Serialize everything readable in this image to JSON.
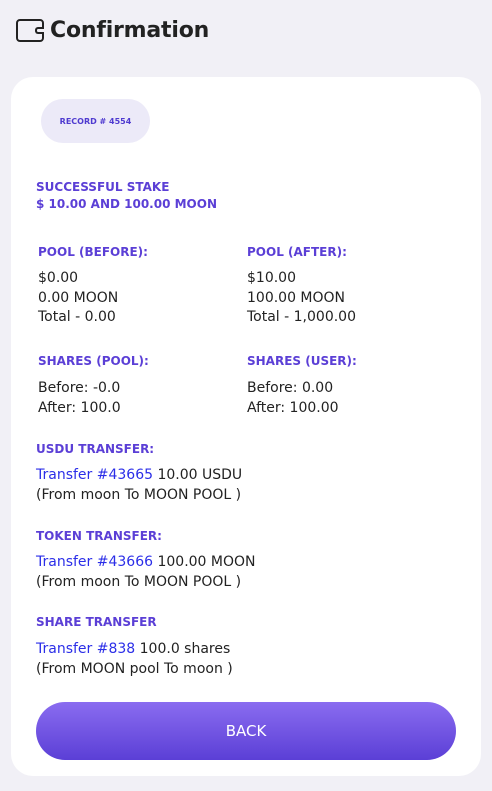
{
  "header": {
    "title": "Confirmation",
    "icon": "wallet-icon"
  },
  "record": {
    "label": "RECORD # 4554"
  },
  "summary": {
    "line1": "SUCCESSFUL STAKE",
    "line2": "$ 10.00 AND 100.00 MOON"
  },
  "pool_before": {
    "heading": "POOL (BEFORE):",
    "usd": "$0.00",
    "moon": "0.00 MOON",
    "total": "Total - 0.00"
  },
  "pool_after": {
    "heading": "POOL (AFTER):",
    "usd": "$10.00",
    "moon": "100.00 MOON",
    "total": "Total - 1,000.00"
  },
  "shares_pool": {
    "heading": "SHARES (POOL):",
    "before": "Before: -0.0",
    "after": "After: 100.0"
  },
  "shares_user": {
    "heading": "SHARES (USER):",
    "before": "Before: 0.00",
    "after": "After: 100.00"
  },
  "usdu_transfer": {
    "heading": "USDU TRANSFER:",
    "link": "Transfer #43665",
    "amount": " 10.00 USDU",
    "route": "(From moon To MOON POOL )"
  },
  "token_transfer": {
    "heading": "TOKEN TRANSFER:",
    "link": "Transfer #43666",
    "amount": " 100.00 MOON",
    "route": "(From moon To MOON POOL )"
  },
  "share_transfer": {
    "heading": "SHARE TRANSFER",
    "link": "Transfer #838",
    "amount": " 100.0 shares",
    "route": "(From MOON pool To moon )"
  },
  "actions": {
    "back_label": "BACK"
  },
  "colors": {
    "accent": "#5b3fd6",
    "link": "#2b2ee8",
    "background": "#f1f0f6"
  }
}
